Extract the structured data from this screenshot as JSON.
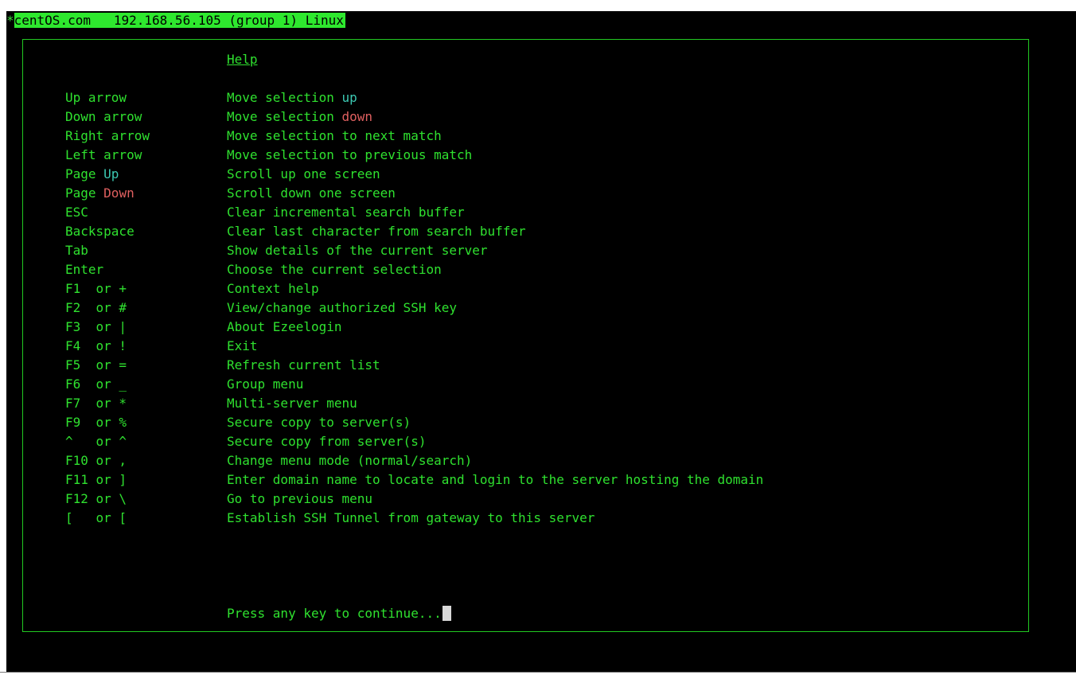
{
  "terminal": {
    "title_marker": "*",
    "title_text": "centOS.com   192.168.56.105 (group 1) Linux"
  },
  "help": {
    "title": "Help",
    "rows": [
      {
        "key": "Up arrow",
        "desc": "Move selection "
      },
      {
        "key": "Down arrow",
        "desc": "Move selection "
      },
      {
        "key": "Right arrow",
        "desc": "Move selection to next match"
      },
      {
        "key": "Left arrow",
        "desc": "Move selection to previous match"
      },
      {
        "key": "Page ",
        "desc": "Scroll up one screen"
      },
      {
        "key": "Page ",
        "desc": "Scroll down one screen"
      },
      {
        "key": "ESC",
        "desc": "Clear incremental search buffer"
      },
      {
        "key": "Backspace",
        "desc": "Clear last character from search buffer"
      },
      {
        "key": "Tab",
        "desc": "Show details of the current server"
      },
      {
        "key": "Enter",
        "desc": "Choose the current selection"
      },
      {
        "key": "F1  or +",
        "desc": "Context help"
      },
      {
        "key": "F2  or #",
        "desc": "View/change authorized SSH key"
      },
      {
        "key": "F3  or |",
        "desc": "About Ezeelogin"
      },
      {
        "key": "F4  or !",
        "desc": "Exit"
      },
      {
        "key": "F5  or =",
        "desc": "Refresh current list"
      },
      {
        "key": "F6  or _",
        "desc": "Group menu"
      },
      {
        "key": "F7  or *",
        "desc": "Multi-server menu"
      },
      {
        "key": "F9  or %",
        "desc": "Secure copy to server(s)"
      },
      {
        "key": "^   or ^",
        "desc": "Secure copy from server(s)"
      },
      {
        "key": "F10 or ,",
        "desc": "Change menu mode (normal/search)"
      },
      {
        "key": "F11 or ]",
        "desc": "Enter domain name to locate and login to the server hosting the domain"
      },
      {
        "key": "F12 or \\",
        "desc": "Go to previous menu"
      },
      {
        "key": "[   or [",
        "desc": "Establish SSH Tunnel from gateway to this server"
      }
    ],
    "highlight_up": "up",
    "highlight_down": "down",
    "highlight_page_up": "Up",
    "highlight_page_down": "Down",
    "footer": "Press any key to continue..."
  },
  "colors": {
    "terminal_bg": "#000000",
    "text_green": "#2fe12f",
    "title_bar_green": "#2ee82e",
    "up_highlight": "#3cc9b3",
    "down_highlight": "#e06060",
    "cursor": "#d8d8d8"
  }
}
